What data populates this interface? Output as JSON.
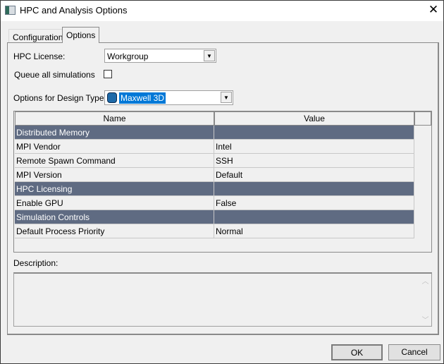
{
  "window": {
    "title": "HPC and Analysis Options",
    "close": "✕"
  },
  "tabs": [
    {
      "label": "Configurations"
    },
    {
      "label": "Options",
      "active": true
    }
  ],
  "form": {
    "hpc_license_label": "HPC License:",
    "hpc_license_value": "Workgroup",
    "queue_label": "Queue all simulations",
    "queue_checked": false,
    "design_type_label": "Options for Design Type:",
    "design_type_value": "Maxwell 3D"
  },
  "grid": {
    "headers": [
      "Name",
      "Value"
    ],
    "rows": [
      {
        "name": "Distributed Memory",
        "value": "",
        "category": true
      },
      {
        "name": "MPI Vendor",
        "value": "Intel"
      },
      {
        "name": "Remote Spawn Command",
        "value": "SSH"
      },
      {
        "name": "MPI Version",
        "value": "Default"
      },
      {
        "name": "HPC Licensing",
        "value": "",
        "category": true
      },
      {
        "name": "Enable GPU",
        "value": "False"
      },
      {
        "name": "Simulation Controls",
        "value": "",
        "category": true
      },
      {
        "name": "Default Process Priority",
        "value": "Normal"
      }
    ],
    "category_color": "#5f6b82"
  },
  "description": {
    "label": "Description:",
    "text": ""
  },
  "buttons": {
    "ok": "OK",
    "cancel": "Cancel"
  }
}
